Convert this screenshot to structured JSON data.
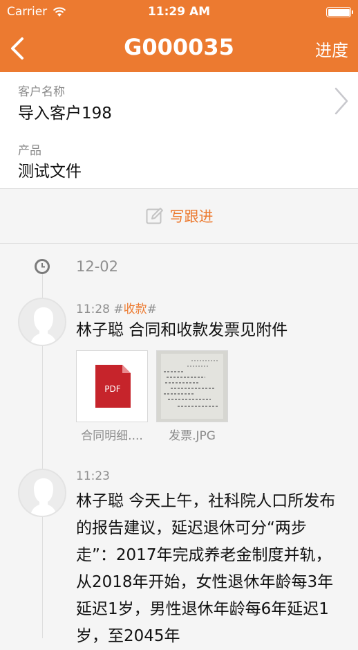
{
  "status_bar": {
    "carrier": "Carrier",
    "time": "11:29 AM"
  },
  "nav": {
    "title": "G000035",
    "progress_label": "进度",
    "back_icon": "chevron-left-icon"
  },
  "customer": {
    "name_label": "客户名称",
    "name_value": "导入客户198",
    "product_label": "产品",
    "product_value": "测试文件"
  },
  "follow_up": {
    "label": "写跟进",
    "icon": "edit-icon"
  },
  "timeline": {
    "date": "12-02",
    "entries": [
      {
        "time": "11:28",
        "tag_prefix": "#",
        "tag": "收款",
        "tag_suffix": "#",
        "text": "林子聪 合同和收款发票见附件",
        "attachments": [
          {
            "name": "合同明细....",
            "badge": "PDF"
          },
          {
            "name": "发票.JPG"
          }
        ]
      },
      {
        "time": "11:23",
        "text": "林子聪 今天上午，社科院人口所发布的报告建议，延迟退休可分“两步走”：2017年完成养老金制度并轨，从2018年开始，女性退休年龄每3年延迟1岁，男性退休年龄每6年延迟1岁，至2045年"
      }
    ]
  },
  "colors": {
    "accent": "#ec7a30",
    "pdf_red": "#c6242b"
  }
}
